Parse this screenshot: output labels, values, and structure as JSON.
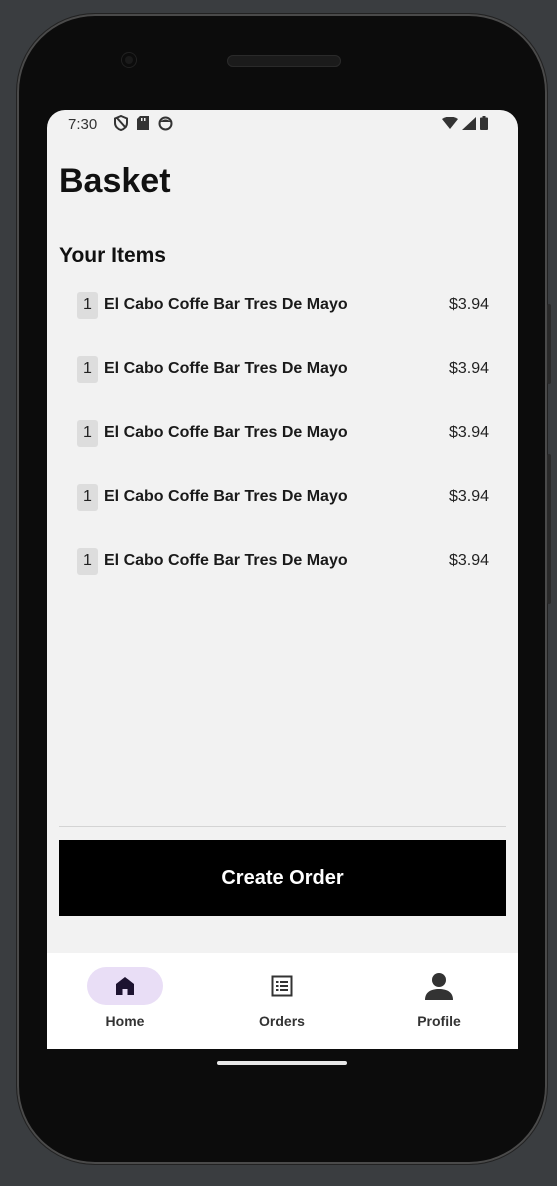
{
  "status_bar": {
    "time": "7:30"
  },
  "page": {
    "title": "Basket",
    "section_title": "Your Items"
  },
  "items": [
    {
      "qty": "1",
      "name": "El Cabo Coffe Bar Tres De Mayo",
      "price": "$3.94"
    },
    {
      "qty": "1",
      "name": "El Cabo Coffe Bar Tres De Mayo",
      "price": "$3.94"
    },
    {
      "qty": "1",
      "name": "El Cabo Coffe Bar Tres De Mayo",
      "price": "$3.94"
    },
    {
      "qty": "1",
      "name": "El Cabo Coffe Bar Tres De Mayo",
      "price": "$3.94"
    },
    {
      "qty": "1",
      "name": "El Cabo Coffe Bar Tres De Mayo",
      "price": "$3.94"
    }
  ],
  "actions": {
    "create_order_label": "Create Order"
  },
  "bottom_nav": {
    "items": [
      {
        "label": "Home",
        "icon": "home-icon",
        "active": true
      },
      {
        "label": "Orders",
        "icon": "orders-list-icon",
        "active": false
      },
      {
        "label": "Profile",
        "icon": "profile-icon",
        "active": false
      }
    ]
  },
  "colors": {
    "accent_active_pill": "#e9def6",
    "button_bg": "#000000",
    "screen_bg": "#f2f2f2"
  }
}
